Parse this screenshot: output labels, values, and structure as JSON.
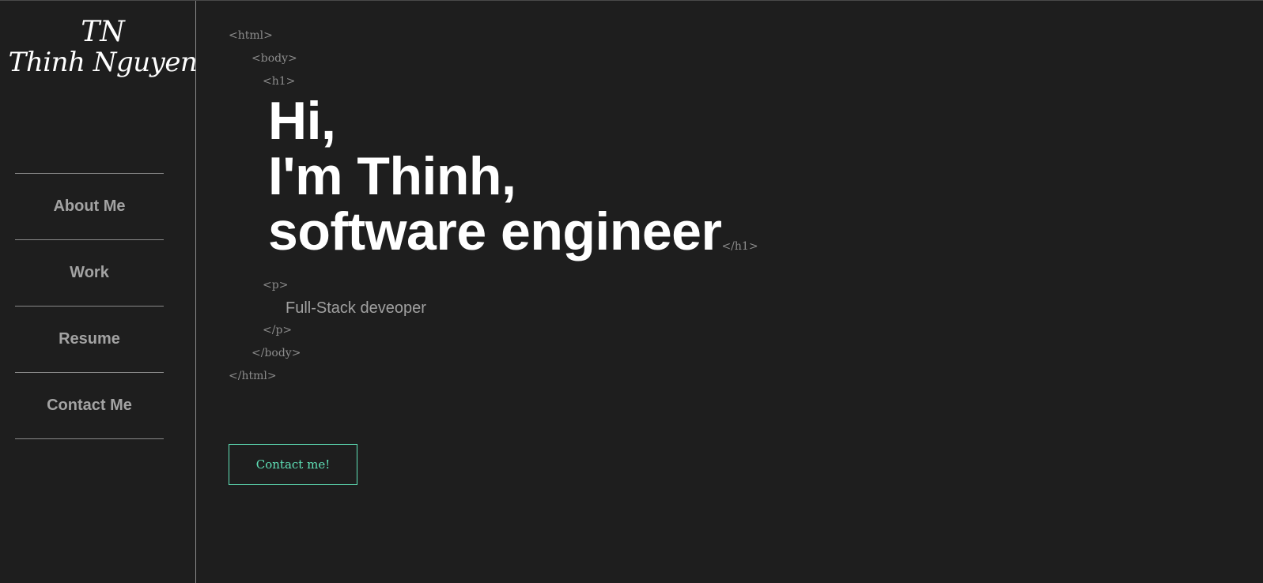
{
  "logo": {
    "initials": "TN",
    "name": "Thinh Nguyen"
  },
  "nav": {
    "items": [
      {
        "label": "About Me"
      },
      {
        "label": "Work"
      },
      {
        "label": "Resume"
      },
      {
        "label": "Contact Me"
      }
    ]
  },
  "main": {
    "tags": {
      "html_open": "<html>",
      "body_open": "<body>",
      "h1_open": "<h1>",
      "h1_close": "</h1>",
      "p_open": "<p>",
      "p_close": "</p>",
      "body_close": "</body>",
      "html_close": "</html>"
    },
    "heading": {
      "line1": "Hi,",
      "line2": "I'm Thinh,",
      "line3": "software engineer"
    },
    "subtitle": "Full-Stack deveoper",
    "contact_button": "Contact me!"
  },
  "colors": {
    "background": "#1e1e1e",
    "accent": "#5fe0b7",
    "divider": "#8a8a8a",
    "nav_text": "#a3a3a3",
    "tag_text": "#8c8c8c"
  }
}
